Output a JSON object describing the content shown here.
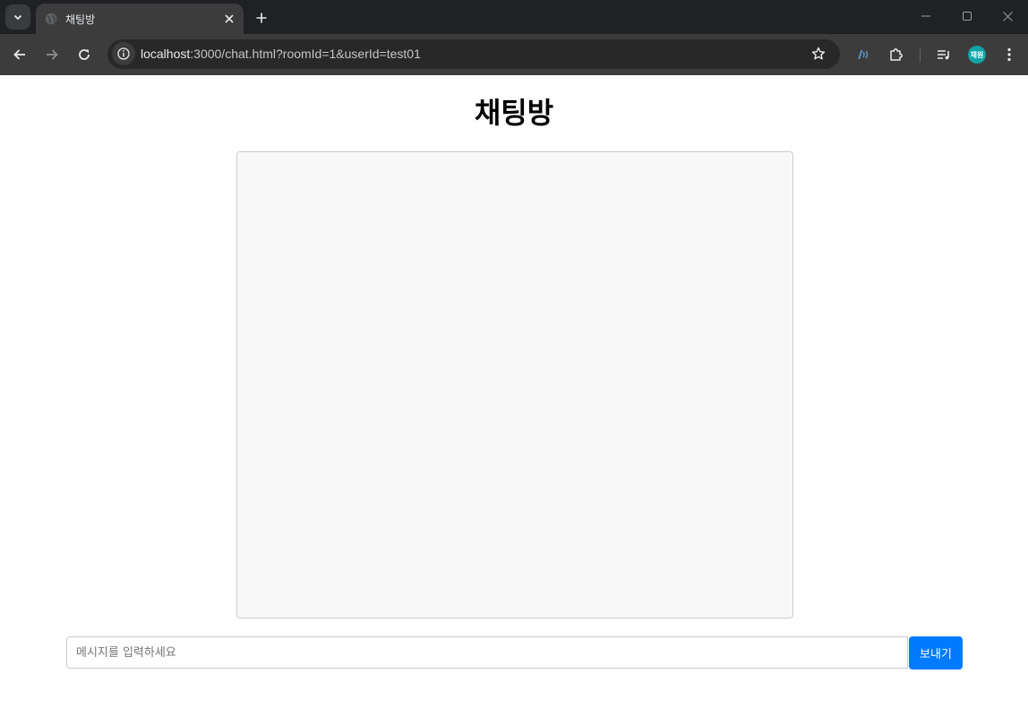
{
  "browser": {
    "tab_title": "채팅방",
    "url_host": "localhost",
    "url_rest": ":3000/chat.html?roomId=1&userId=test01",
    "profile_initials": "채원",
    "theme": {
      "tabbar": "#202124",
      "toolbar": "#3c3c3c",
      "omnibox": "#282828",
      "profile": "#11a3a8",
      "ext_accent": "#5b9bd5"
    },
    "icons": [
      "tab-list-chevron-icon",
      "globe-icon",
      "close-icon",
      "plus-icon",
      "minimize-icon",
      "maximize-icon",
      "close-window-icon",
      "back-arrow-icon",
      "forward-arrow-icon",
      "reload-icon",
      "info-icon",
      "star-icon",
      "extension-broadcast-icon",
      "puzzle-icon",
      "media-queue-icon",
      "kebab-menu-icon"
    ]
  },
  "page": {
    "title": "채팅방",
    "message_placeholder": "메시지를 입력하세요",
    "message_value": "",
    "send_label": "보내기",
    "send_color": "#007bff",
    "chat_bg": "#f8f8f8"
  }
}
